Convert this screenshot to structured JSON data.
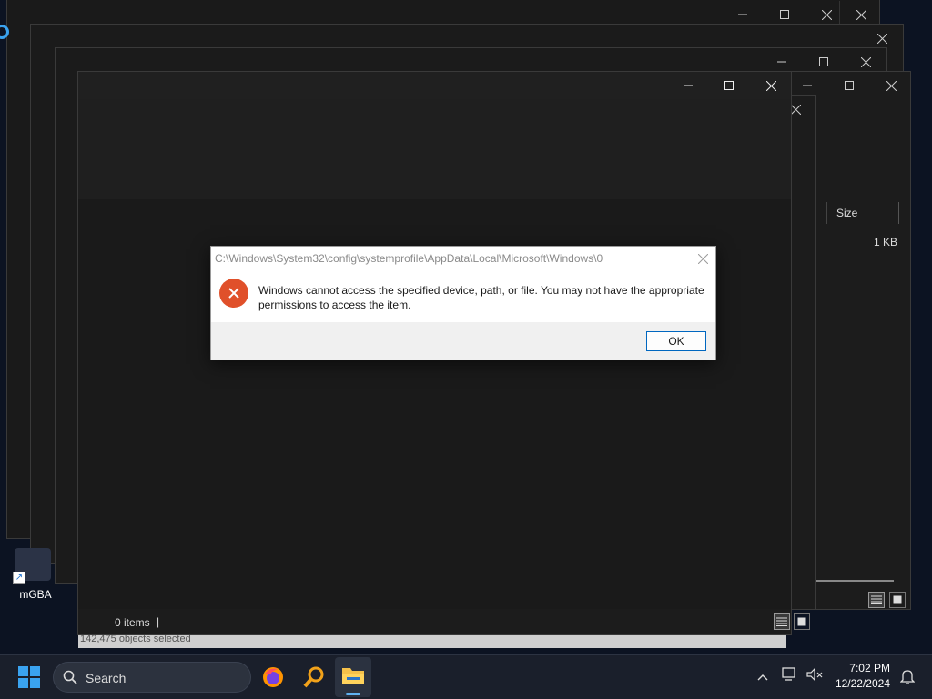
{
  "desktop": {
    "shortcut_label": "mGBA"
  },
  "back_windows": {
    "size_column_header": "Size",
    "size_value": "1 KB",
    "objects_selected_status": "142,475 objects selected"
  },
  "main_window": {
    "status_items": "0 items",
    "status_separator": "|"
  },
  "dialog": {
    "title": "C:\\Windows\\System32\\config\\systemprofile\\AppData\\Local\\Microsoft\\Windows\\0",
    "message": "Windows cannot access the specified device, path, or file. You may not have the appropriate permissions to access the item.",
    "ok_label": "OK",
    "error_icon": "error-x-icon",
    "error_color": "#e0502a"
  },
  "taskbar": {
    "search_label": "Search",
    "time": "7:02 PM",
    "date": "12/22/2024",
    "start_color": "#3aa3f0"
  }
}
